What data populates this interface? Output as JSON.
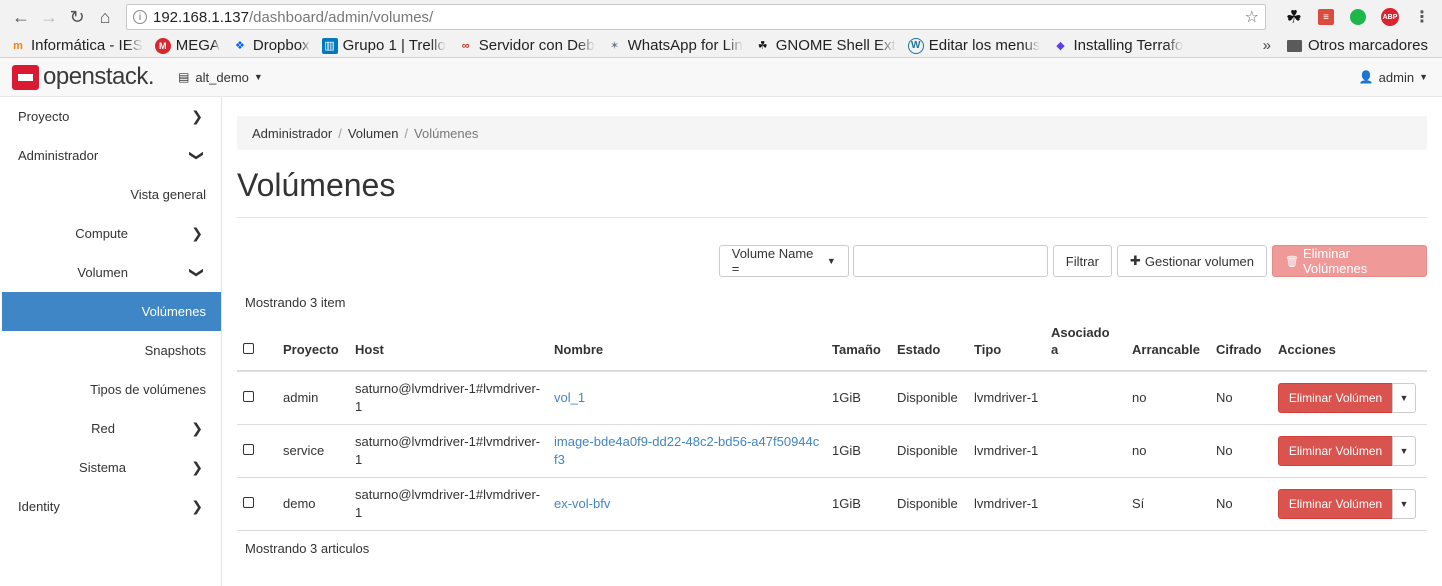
{
  "browser": {
    "url_host": "192.168.1.137",
    "url_path": "/dashboard/admin/volumes/",
    "bookmarks": [
      {
        "label": "Informática - IES",
        "icon": "moodle-icon",
        "icon_color": "#f98012"
      },
      {
        "label": "MEGA",
        "icon": "mega-icon",
        "icon_color": "#d9272e"
      },
      {
        "label": "Dropbox",
        "icon": "dropbox-icon",
        "icon_color": "#0061ff"
      },
      {
        "label": "Grupo 1 | Trello",
        "icon": "trello-icon",
        "icon_color": "#0079bf"
      },
      {
        "label": "Servidor con Deb",
        "icon": "link-icon",
        "icon_color": "#c0392b"
      },
      {
        "label": "WhatsApp for Lin",
        "icon": "bug-icon",
        "icon_color": "#6a7b8c"
      },
      {
        "label": "GNOME Shell Ext",
        "icon": "gnome-icon",
        "icon_color": "#111111"
      },
      {
        "label": "Editar los menus",
        "icon": "wordpress-icon",
        "icon_color": "#21759b"
      },
      {
        "label": "Installing Terrafo",
        "icon": "terraform-icon",
        "icon_color": "#623ce4"
      }
    ],
    "more": "»",
    "other_bookmarks": "Otros marcadores"
  },
  "header": {
    "logo_text": "openstack.",
    "project": "alt_demo",
    "user": "admin"
  },
  "sidebar": {
    "items": [
      {
        "label": "Proyecto",
        "chevron": "right"
      },
      {
        "label": "Administrador",
        "chevron": "down"
      },
      {
        "label": "Vista general"
      },
      {
        "label": "Compute",
        "chevron": "right"
      },
      {
        "label": "Volumen",
        "chevron": "down"
      },
      {
        "label": "Volúmenes",
        "active": true
      },
      {
        "label": "Snapshots"
      },
      {
        "label": "Tipos de volúmenes"
      },
      {
        "label": "Red",
        "chevron": "right"
      },
      {
        "label": "Sistema",
        "chevron": "right"
      },
      {
        "label": "Identity",
        "chevron": "right"
      }
    ]
  },
  "breadcrumb": [
    "Administrador",
    "Volumen",
    "Volúmenes"
  ],
  "page_title": "Volúmenes",
  "toolbar": {
    "filter_field": "Volume Name =",
    "filter_value": "",
    "filter_button": "Filtrar",
    "manage_button": "Gestionar volumen",
    "delete_button": "Eliminar Volúmenes"
  },
  "count_top": "Mostrando 3 item",
  "count_bottom": "Mostrando 3 articulos",
  "table": {
    "headers": [
      "Proyecto",
      "Host",
      "Nombre",
      "Tamaño",
      "Estado",
      "Tipo",
      "Asociado a",
      "Arrancable",
      "Cifrado",
      "Acciones"
    ],
    "rows": [
      {
        "project": "admin",
        "host": "saturno@lvmdriver-1#lvmdriver-1",
        "name": "vol_1",
        "size": "1GiB",
        "status": "Disponible",
        "type": "lvmdriver-1",
        "attached": "",
        "bootable": "no",
        "encrypted": "No",
        "action": "Eliminar Volúmen"
      },
      {
        "project": "service",
        "host": "saturno@lvmdriver-1#lvmdriver-1",
        "name": "image-bde4a0f9-dd22-48c2-bd56-a47f50944cf3",
        "size": "1GiB",
        "status": "Disponible",
        "type": "lvmdriver-1",
        "attached": "",
        "bootable": "no",
        "encrypted": "No",
        "action": "Eliminar Volúmen"
      },
      {
        "project": "demo",
        "host": "saturno@lvmdriver-1#lvmdriver-1",
        "name": "ex-vol-bfv",
        "size": "1GiB",
        "status": "Disponible",
        "type": "lvmdriver-1",
        "attached": "",
        "bootable": "Sí",
        "encrypted": "No",
        "action": "Eliminar Volúmen"
      }
    ]
  },
  "colors": {
    "accent": "#3f86c7",
    "danger": "#d9534f",
    "danger_disabled": "#ef9a99",
    "brand": "#da1a32"
  }
}
